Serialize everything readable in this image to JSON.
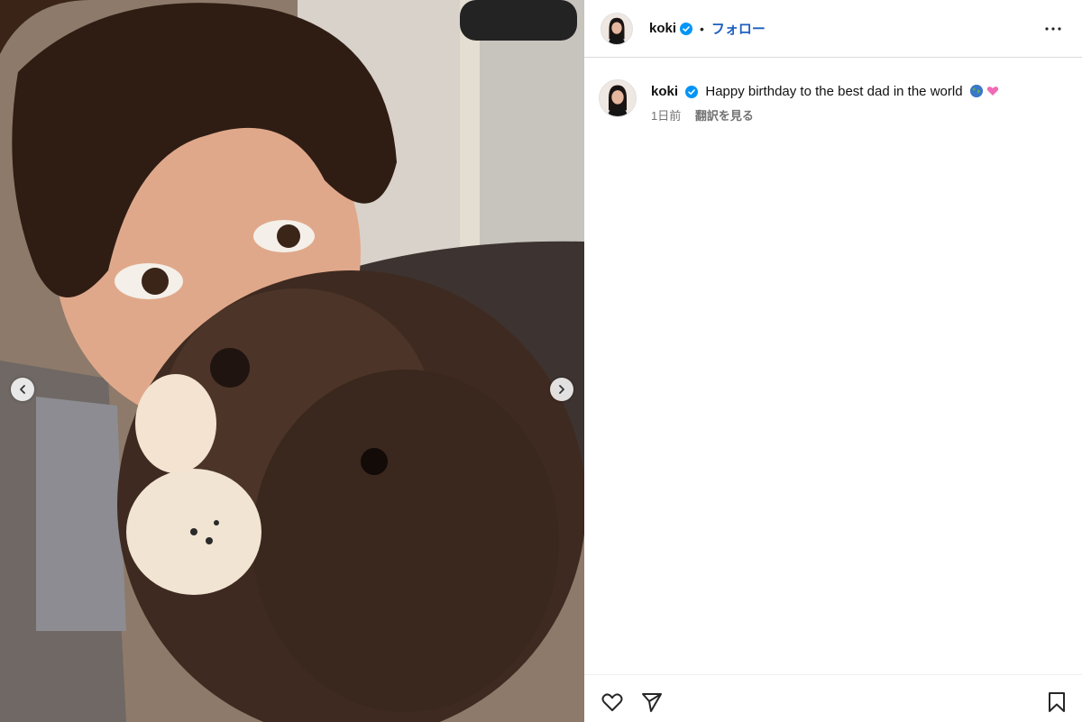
{
  "header": {
    "username": "koki",
    "separator": "•",
    "follow_label": "フォロー"
  },
  "caption": {
    "username": "koki",
    "text": "Happy birthday to the best dad in the world",
    "time": "1日前",
    "translate_label": "翻訳を見る"
  },
  "colors": {
    "verified": "#0095f6",
    "follow": "#1d5fbf",
    "meta": "#737373",
    "border": "#dbdbdb"
  },
  "icons": {
    "prev": "chevron-left-icon",
    "next": "chevron-right-icon",
    "more": "more-horizontal-icon",
    "like": "heart-icon",
    "share": "paper-plane-icon",
    "save": "bookmark-icon"
  }
}
